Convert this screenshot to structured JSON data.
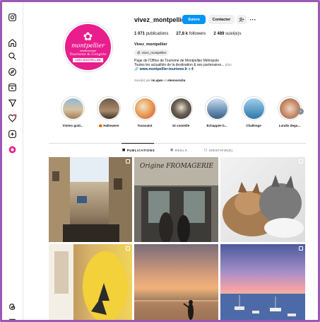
{
  "profile": {
    "username": "vivez_montpellier",
    "avatar": {
      "logo_text": "montpellier",
      "sub_text": "méditerranée",
      "script_text": "Tourisme & Congrès",
      "banner_text": "VIVEZ MONTPELLIER",
      "bg_color": "#e91e8c"
    },
    "buttons": {
      "follow": "Suivre",
      "contact": "Contacter",
      "add_user": "+&",
      "more": "···"
    },
    "stats": {
      "posts_count": "1 071",
      "posts_label": "publications",
      "followers_count": "27,8 k",
      "followers_label": "followers",
      "following_count": "2 489",
      "following_label": "suivi(e)s"
    },
    "bio": {
      "name": "Vivez_montpellier",
      "threads_handle": "vivez_montpellier",
      "line1": "Page de l'Office de Tourisme de Montpellier Métropole",
      "line2": "Toutes les actualités de la destination & ses partenaires...",
      "more": "plus",
      "link": "www.montpellier-tourisme.fr + 4"
    },
    "followed_by": {
      "prefix": "Suivi(e) par",
      "user1": "im.ajwo",
      "joiner": "et",
      "user2": "eleonoreztu"
    }
  },
  "highlights": [
    {
      "label": "Visites guid...",
      "color": "#c9a57a"
    },
    {
      "label": "🎃 Halloween",
      "color": "#8a6f55"
    },
    {
      "label": "Toussaint",
      "color": "#e8a35a"
    },
    {
      "label": "10 comédie",
      "color": "#4a4a4a"
    },
    {
      "label": "Échappée b...",
      "color": "#6b8fb5"
    },
    {
      "label": "Challenge",
      "color": "#5f9ec7"
    },
    {
      "label": "Lundis degu...",
      "color": "#c98f6c"
    }
  ],
  "tabs": {
    "posts": "PUBLICATIONS",
    "reels": "REELS",
    "tagged": "IDENTIFIÉ(E)"
  },
  "grid": {
    "tile2_sign": "Origine FROMAGERIE"
  }
}
